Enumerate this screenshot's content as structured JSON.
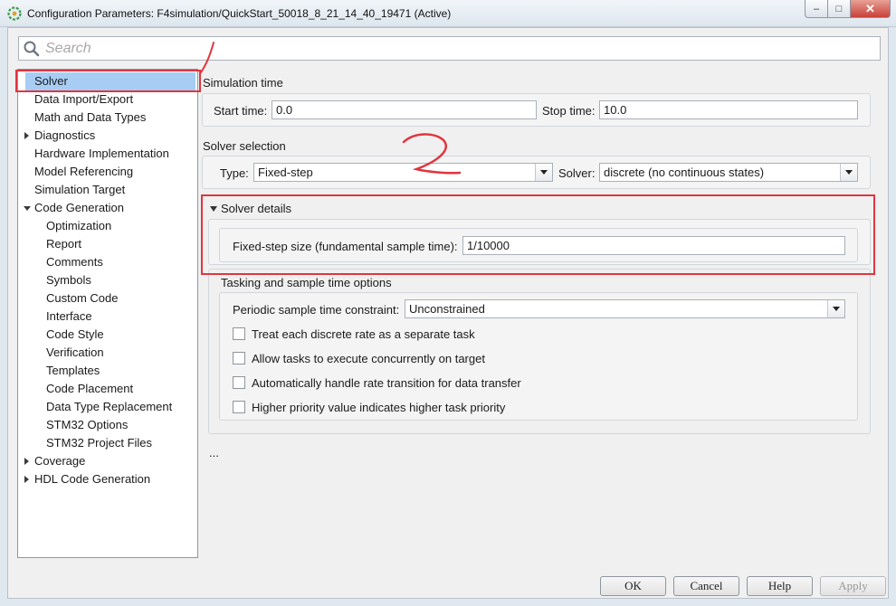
{
  "window": {
    "title": "Configuration Parameters: F4simulation/QuickStart_50018_8_21_14_40_19471 (Active)",
    "controls": {
      "minimize": "–",
      "maximize": "□",
      "close": "✕"
    }
  },
  "search": {
    "placeholder": "Search"
  },
  "tree": {
    "items": [
      {
        "label": "Solver",
        "selected": true
      },
      {
        "label": "Data Import/Export"
      },
      {
        "label": "Math and Data Types"
      },
      {
        "label": "Diagnostics",
        "expander": "collapsed"
      },
      {
        "label": "Hardware Implementation"
      },
      {
        "label": "Model Referencing"
      },
      {
        "label": "Simulation Target"
      },
      {
        "label": "Code Generation",
        "expander": "expanded"
      },
      {
        "label": "Optimization"
      },
      {
        "label": "Report"
      },
      {
        "label": "Comments"
      },
      {
        "label": "Symbols"
      },
      {
        "label": "Custom Code"
      },
      {
        "label": "Interface"
      },
      {
        "label": "Code Style"
      },
      {
        "label": "Verification"
      },
      {
        "label": "Templates"
      },
      {
        "label": "Code Placement"
      },
      {
        "label": "Data Type Replacement"
      },
      {
        "label": "STM32 Options"
      },
      {
        "label": "STM32 Project Files"
      },
      {
        "label": "Coverage",
        "expander": "collapsed"
      },
      {
        "label": "HDL Code Generation",
        "expander": "collapsed"
      }
    ]
  },
  "simulation_time": {
    "heading": "Simulation time",
    "start_label": "Start time:",
    "start_value": "0.0",
    "stop_label": "Stop time:",
    "stop_value": "10.0"
  },
  "solver_selection": {
    "heading": "Solver selection",
    "type_label": "Type:",
    "type_value": "Fixed-step",
    "solver_label": "Solver:",
    "solver_value": "discrete (no continuous states)"
  },
  "solver_details": {
    "heading": "Solver details",
    "step_label": "Fixed-step size (fundamental sample time):",
    "step_value": "1/10000"
  },
  "tasking": {
    "heading": "Tasking and sample time options",
    "constraint_label": "Periodic sample time constraint:",
    "constraint_value": "Unconstrained",
    "options": [
      {
        "label": "Treat each discrete rate as a separate task",
        "checked": false
      },
      {
        "label": "Allow tasks to execute concurrently on target",
        "checked": false
      },
      {
        "label": "Automatically handle rate transition for data transfer",
        "checked": false
      },
      {
        "label": "Higher priority value indicates higher task priority",
        "checked": false
      }
    ]
  },
  "more": "...",
  "buttons": {
    "ok": "OK",
    "cancel": "Cancel",
    "help": "Help",
    "apply": "Apply"
  },
  "colors": {
    "annotation": "#e0353f",
    "selection": "#a8cdf5"
  }
}
